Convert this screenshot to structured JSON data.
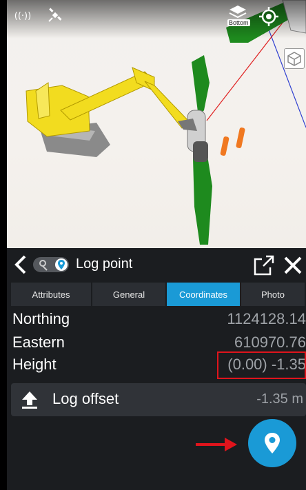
{
  "viewport": {
    "bottom_view_label": "Bottom",
    "icons": [
      "signal-icon",
      "satellite-icon",
      "layers-icon",
      "locate-icon",
      "cube-view-icon"
    ]
  },
  "panel": {
    "title": "Log point",
    "tabs": [
      {
        "label": "Attributes",
        "active": false
      },
      {
        "label": "General",
        "active": false
      },
      {
        "label": "Coordinates",
        "active": true
      },
      {
        "label": "Photo",
        "active": false
      }
    ],
    "coordinates": [
      {
        "label": "Northing",
        "value": "1124128.14"
      },
      {
        "label": "Eastern",
        "value": "610970.76"
      },
      {
        "label": "Height",
        "value": "(0.00) -1.35"
      }
    ],
    "log_offset": {
      "label": "Log offset",
      "value": "-1.35 m"
    }
  },
  "colors": {
    "accent": "#1a9ad6",
    "panel_bg": "#1b1d20",
    "highlight": "#e0141c",
    "excavator": "#f2dc1f",
    "pipe": "#1e8a1e"
  }
}
